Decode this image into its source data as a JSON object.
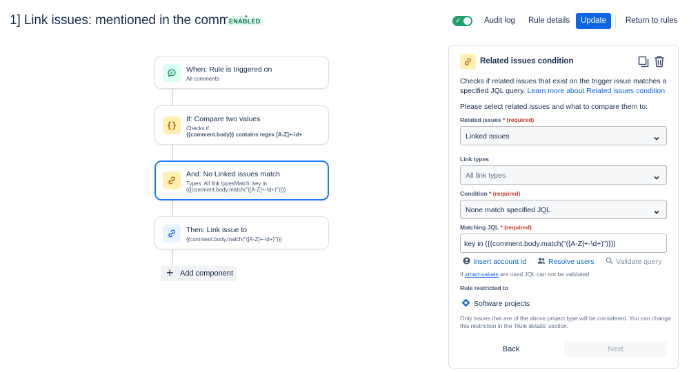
{
  "header": {
    "title": "1] Link issues: mentioned in the comment",
    "badge": "ENABLED",
    "toggle_enabled": true,
    "audit_log": "Audit log",
    "rule_details": "Rule details",
    "update": "Update",
    "return_to_rules": "Return to rules"
  },
  "flow": {
    "trigger": {
      "title": "When: Rule is triggered on",
      "subtitle": "All comments",
      "icon": "comment-icon"
    },
    "condition": {
      "title": "If: Compare two values",
      "subtitle_prefix": "Checks if:",
      "subtitle_bold": "{{comment.body}} contains regex [A-Z]+-\\d+",
      "icon": "braces-icon"
    },
    "and_condition": {
      "title": "And: No Linked issues match",
      "subtitle_line1": "Types: All link typesMatch: key in",
      "subtitle_line2": "({{comment.body.match(\"([A-Z]+-\\d+)\")}})",
      "icon": "link-icon"
    },
    "action": {
      "title": "Then: Link issue to",
      "subtitle": "{{comment.body.match(\"([A-Z]+-\\d+)\")}}",
      "icon": "link-icon"
    },
    "add_component": "Add component"
  },
  "panel": {
    "title": "Related issues condition",
    "description_text": "Checks if related issues that exist on the trigger issue matches a specified JQL query. ",
    "description_link": "Learn more about Related issues condition",
    "prompt": "Please select related issues and what to compare them to:",
    "related_issues": {
      "label": "Related issues",
      "required_mark": "*",
      "required_text": "(required)",
      "value": "Linked issues"
    },
    "link_types": {
      "label": "Link types",
      "placeholder": "All link types"
    },
    "condition": {
      "label": "Condition",
      "required_mark": "*",
      "required_text": "(required)",
      "value": "None match specified JQL"
    },
    "matching_jql": {
      "label": "Matching JQL",
      "required_mark": "*",
      "required_text": "(required)",
      "value": "key in ({{comment.body.match(\"([A-Z]+-\\d+)\")}})"
    },
    "insert_account_id": "Insert account id",
    "resolve_users": "Resolve users",
    "validate_query": "Validate query",
    "note_prefix": "If ",
    "note_link": "smart-values",
    "note_suffix": " are used JQL can not be validated.",
    "restricted_label": "Rule restricted to",
    "project_type": "Software projects",
    "restricted_note": "Only issues that are of the above project type will be considered. You can change this restriction in the 'Rule details' section.",
    "back": "Back",
    "next": "Next"
  },
  "colors": {
    "primary": "#0c66e4",
    "toggle_on": "#22a06b",
    "required": "#c9372c",
    "selected_border": "#1d7afc"
  }
}
